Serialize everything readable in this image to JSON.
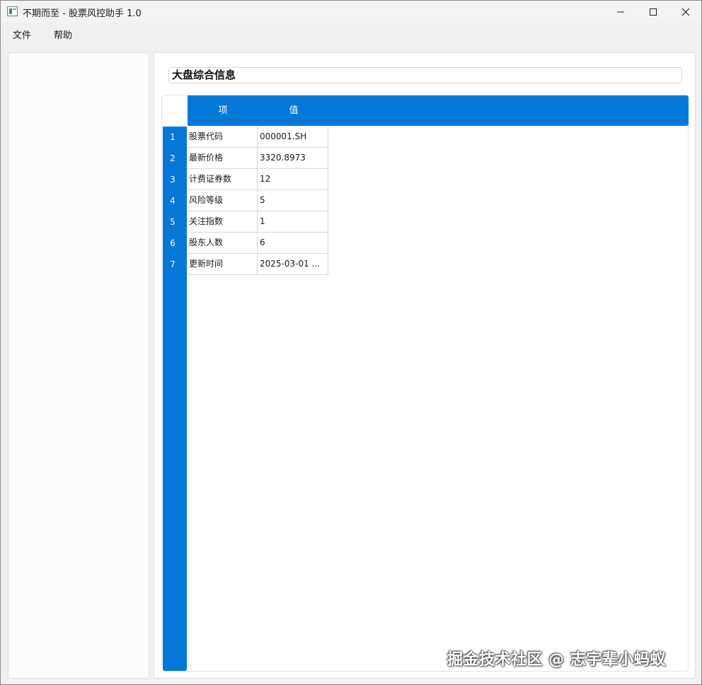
{
  "window": {
    "title": "不期而至 - 股票风控助手 1.0"
  },
  "menu": {
    "items": [
      "文件",
      "帮助"
    ]
  },
  "main": {
    "section_title": "大盘综合信息",
    "table": {
      "columns": [
        "项",
        "值"
      ],
      "rows": [
        {
          "num": "1",
          "item": "股票代码",
          "value": "000001.SH"
        },
        {
          "num": "2",
          "item": "最新价格",
          "value": "3320.8973"
        },
        {
          "num": "3",
          "item": "计费证券数",
          "value": "12"
        },
        {
          "num": "4",
          "item": "风险等级",
          "value": "5"
        },
        {
          "num": "5",
          "item": "关注指数",
          "value": "1"
        },
        {
          "num": "6",
          "item": "股东人数",
          "value": "6"
        },
        {
          "num": "7",
          "item": "更新时间",
          "value": "2025-03-01 ..."
        }
      ]
    }
  },
  "watermark": "掘金技术社区 @ 志宇辈小蚂蚁",
  "colors": {
    "header_blue": "#0578d7",
    "window_bg": "#f0f0f0"
  },
  "icons": {
    "app": "app-window-icon",
    "minimize": "minimize-icon",
    "maximize": "maximize-icon",
    "close": "close-icon"
  }
}
